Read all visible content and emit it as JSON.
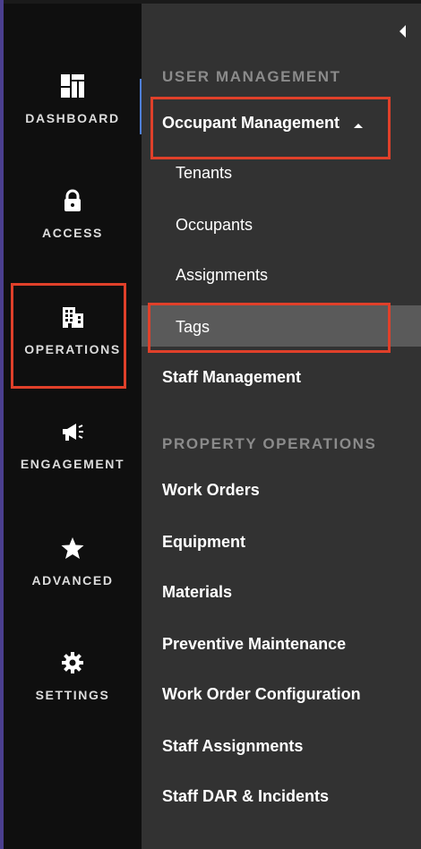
{
  "rail": {
    "items": [
      {
        "label": "DASHBOARD",
        "icon": "dashboard-icon"
      },
      {
        "label": "ACCESS",
        "icon": "lock-icon"
      },
      {
        "label": "OPERATIONS",
        "icon": "building-icon"
      },
      {
        "label": "ENGAGEMENT",
        "icon": "megaphone-icon"
      },
      {
        "label": "ADVANCED",
        "icon": "star-icon"
      },
      {
        "label": "SETTINGS",
        "icon": "gear-icon"
      }
    ]
  },
  "panel": {
    "sections": [
      {
        "header": "USER MANAGEMENT",
        "items": [
          {
            "label": "Occupant Management",
            "expanded": true,
            "children": [
              "Tenants",
              "Occupants",
              "Assignments",
              "Tags"
            ]
          },
          {
            "label": "Staff Management"
          }
        ]
      },
      {
        "header": "PROPERTY OPERATIONS",
        "items": [
          {
            "label": "Work Orders"
          },
          {
            "label": "Equipment"
          },
          {
            "label": "Materials"
          },
          {
            "label": "Preventive Maintenance"
          },
          {
            "label": "Work Order Configuration"
          },
          {
            "label": "Staff Assignments"
          },
          {
            "label": "Staff DAR & Incidents"
          }
        ]
      }
    ],
    "selected_item": "Tags"
  },
  "colors": {
    "rail_bg": "#0f0f0f",
    "panel_bg": "#323232",
    "selected_bg": "#5a5a5a",
    "section_header": "#8b8b8b",
    "active_indicator": "#4e7fd8",
    "annotation": "#e0402a"
  }
}
